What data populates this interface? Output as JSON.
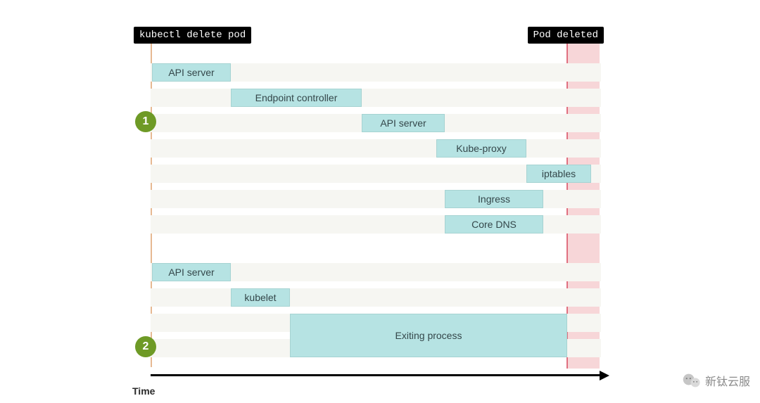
{
  "colors": {
    "bar": "#b6e3e3",
    "lane": "#f6f6f2",
    "badge": "#6e9a26",
    "end_band": "#f4c4c8",
    "start_marker": "#d58a4a",
    "tag_bg": "#000000",
    "tag_fg": "#ffffff"
  },
  "tags": {
    "start": "kubectl delete pod",
    "end": "Pod deleted"
  },
  "badges": {
    "one": "1",
    "two": "2"
  },
  "group1": {
    "api_server_1": "API server",
    "endpoint_controller": "Endpoint controller",
    "api_server_2": "API server",
    "kube_proxy": "Kube-proxy",
    "iptables": "iptables",
    "ingress": "Ingress",
    "core_dns": "Core DNS"
  },
  "group2": {
    "api_server": "API server",
    "kubelet": "kubelet",
    "exiting_process": "Exiting process"
  },
  "axis": {
    "label": "Time"
  },
  "watermark": {
    "text": "新钛云服"
  }
}
